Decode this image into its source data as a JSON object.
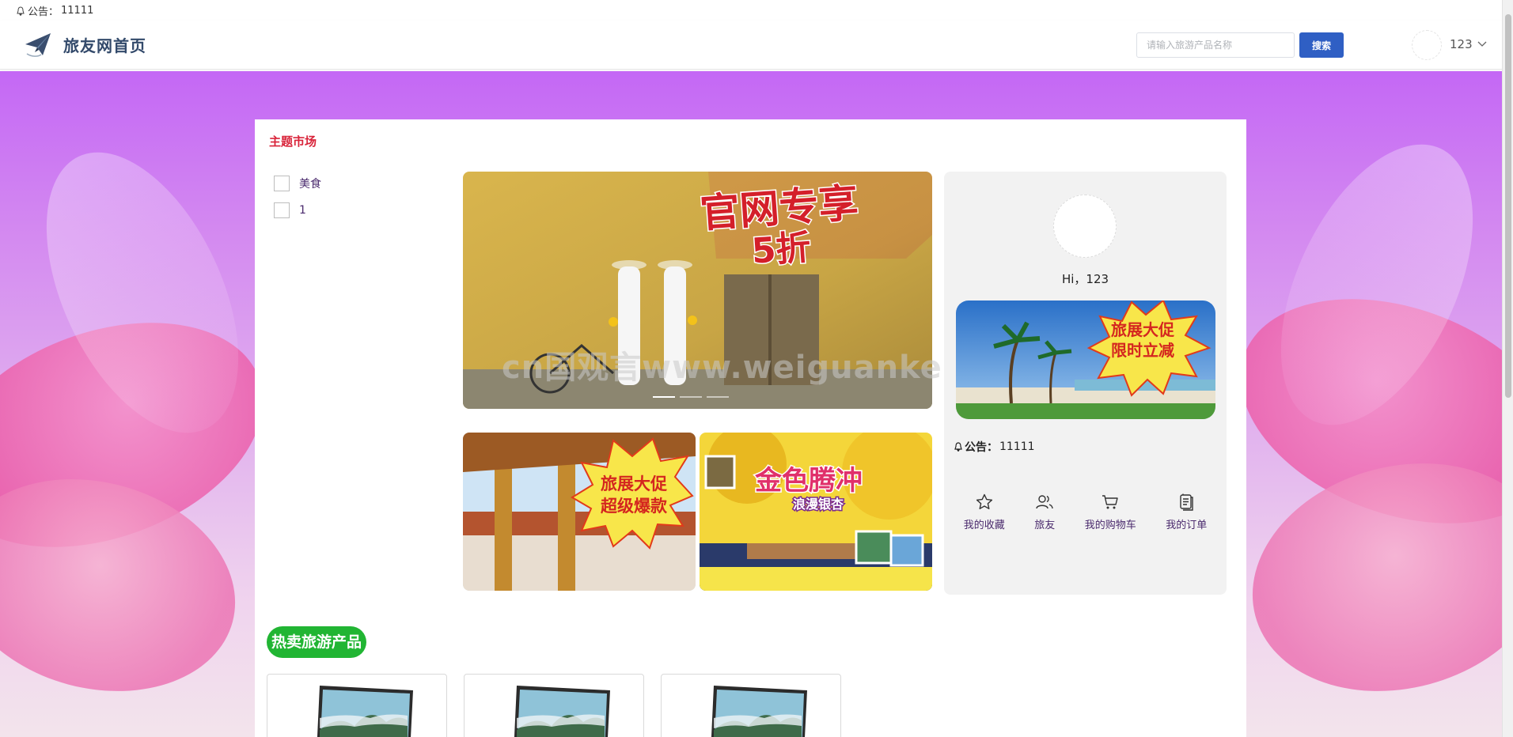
{
  "notice_bar": {
    "label": "公告：",
    "text": "11111"
  },
  "header": {
    "title": "旅友网首页",
    "search_placeholder": "请输入旅游产品名称",
    "search_button": "搜索",
    "username": "123"
  },
  "main": {
    "section_title": "主题市场",
    "categories": [
      {
        "label": "美食",
        "checked": false
      },
      {
        "label": "1",
        "checked": false
      }
    ],
    "banner": {
      "headline_1": "官网专享",
      "headline_2": "5折",
      "slide_count": 3,
      "active_slide": 1
    },
    "thumbs": [
      {
        "line1": "旅展大促",
        "line2": "超级爆款"
      },
      {
        "line1": "金色腾冲",
        "line2": "浪漫银杏"
      }
    ],
    "watermark": "cn国观言www.weiguanke.cn",
    "side_panel": {
      "greeting": "Hi，123",
      "promo_line1": "旅展大促",
      "promo_line2": "限时立减",
      "notice_label": "公告：",
      "notice_text": "11111",
      "quick_links": [
        {
          "label": "我的收藏",
          "icon": "star-icon"
        },
        {
          "label": "旅友",
          "icon": "users-icon"
        },
        {
          "label": "我的购物车",
          "icon": "cart-icon"
        },
        {
          "label": "我的订单",
          "icon": "orders-icon"
        }
      ]
    },
    "hot_title": "热卖旅游产品",
    "products": [
      {
        "image": "laptop-landscape"
      },
      {
        "image": "laptop-landscape"
      },
      {
        "image": "laptop-landscape"
      }
    ]
  },
  "colors": {
    "accent": "#2f5fc4",
    "section_title": "#d9243a",
    "hot_badge": "#21b533",
    "bg_top": "#c468f5"
  }
}
